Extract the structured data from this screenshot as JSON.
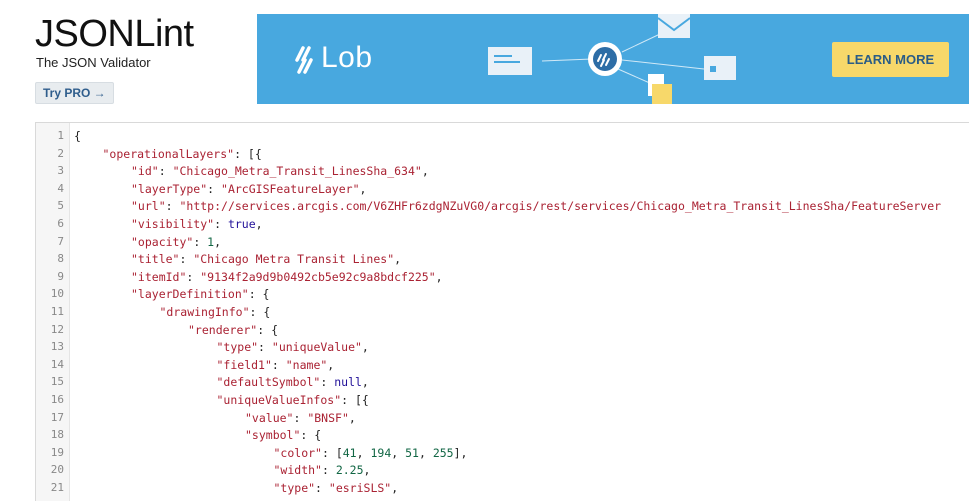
{
  "brand": {
    "title": "JSONLint",
    "subtitle": "The JSON Validator",
    "try_pro_label": "Try PRO →"
  },
  "ad": {
    "logo_text": "Lob",
    "cta_label": "LEARN MORE",
    "background": "#48a8df",
    "cta_color": "#f7d86a"
  },
  "editor": {
    "lines": [
      {
        "num": "1",
        "indent": 0,
        "tokens": [
          {
            "t": "p",
            "v": "{"
          }
        ]
      },
      {
        "num": "2",
        "indent": 1,
        "tokens": [
          {
            "t": "k",
            "v": "\"operationalLayers\""
          },
          {
            "t": "p",
            "v": ": [{"
          }
        ]
      },
      {
        "num": "3",
        "indent": 2,
        "tokens": [
          {
            "t": "k",
            "v": "\"id\""
          },
          {
            "t": "p",
            "v": ": "
          },
          {
            "t": "s",
            "v": "\"Chicago_Metra_Transit_LinesSha_634\""
          },
          {
            "t": "p",
            "v": ","
          }
        ]
      },
      {
        "num": "4",
        "indent": 2,
        "tokens": [
          {
            "t": "k",
            "v": "\"layerType\""
          },
          {
            "t": "p",
            "v": ": "
          },
          {
            "t": "s",
            "v": "\"ArcGISFeatureLayer\""
          },
          {
            "t": "p",
            "v": ","
          }
        ]
      },
      {
        "num": "5",
        "indent": 2,
        "tokens": [
          {
            "t": "k",
            "v": "\"url\""
          },
          {
            "t": "p",
            "v": ": "
          },
          {
            "t": "s",
            "v": "\"http://services.arcgis.com/V6ZHFr6zdgNZuVG0/arcgis/rest/services/Chicago_Metra_Transit_LinesSha/FeatureServer"
          }
        ]
      },
      {
        "num": "6",
        "indent": 2,
        "tokens": [
          {
            "t": "k",
            "v": "\"visibility\""
          },
          {
            "t": "p",
            "v": ": "
          },
          {
            "t": "b",
            "v": "true"
          },
          {
            "t": "p",
            "v": ","
          }
        ]
      },
      {
        "num": "7",
        "indent": 2,
        "tokens": [
          {
            "t": "k",
            "v": "\"opacity\""
          },
          {
            "t": "p",
            "v": ": "
          },
          {
            "t": "n",
            "v": "1"
          },
          {
            "t": "p",
            "v": ","
          }
        ]
      },
      {
        "num": "8",
        "indent": 2,
        "tokens": [
          {
            "t": "k",
            "v": "\"title\""
          },
          {
            "t": "p",
            "v": ": "
          },
          {
            "t": "s",
            "v": "\"Chicago Metra Transit Lines\""
          },
          {
            "t": "p",
            "v": ","
          }
        ]
      },
      {
        "num": "9",
        "indent": 2,
        "tokens": [
          {
            "t": "k",
            "v": "\"itemId\""
          },
          {
            "t": "p",
            "v": ": "
          },
          {
            "t": "s",
            "v": "\"9134f2a9d9b0492cb5e92c9a8bdcf225\""
          },
          {
            "t": "p",
            "v": ","
          }
        ]
      },
      {
        "num": "10",
        "indent": 2,
        "tokens": [
          {
            "t": "k",
            "v": "\"layerDefinition\""
          },
          {
            "t": "p",
            "v": ": {"
          }
        ]
      },
      {
        "num": "11",
        "indent": 3,
        "tokens": [
          {
            "t": "k",
            "v": "\"drawingInfo\""
          },
          {
            "t": "p",
            "v": ": {"
          }
        ]
      },
      {
        "num": "12",
        "indent": 4,
        "tokens": [
          {
            "t": "k",
            "v": "\"renderer\""
          },
          {
            "t": "p",
            "v": ": {"
          }
        ]
      },
      {
        "num": "13",
        "indent": 5,
        "tokens": [
          {
            "t": "k",
            "v": "\"type\""
          },
          {
            "t": "p",
            "v": ": "
          },
          {
            "t": "s",
            "v": "\"uniqueValue\""
          },
          {
            "t": "p",
            "v": ","
          }
        ]
      },
      {
        "num": "14",
        "indent": 5,
        "tokens": [
          {
            "t": "k",
            "v": "\"field1\""
          },
          {
            "t": "p",
            "v": ": "
          },
          {
            "t": "s",
            "v": "\"name\""
          },
          {
            "t": "p",
            "v": ","
          }
        ]
      },
      {
        "num": "15",
        "indent": 5,
        "tokens": [
          {
            "t": "k",
            "v": "\"defaultSymbol\""
          },
          {
            "t": "p",
            "v": ": "
          },
          {
            "t": "b",
            "v": "null"
          },
          {
            "t": "p",
            "v": ","
          }
        ]
      },
      {
        "num": "16",
        "indent": 5,
        "tokens": [
          {
            "t": "k",
            "v": "\"uniqueValueInfos\""
          },
          {
            "t": "p",
            "v": ": [{"
          }
        ]
      },
      {
        "num": "17",
        "indent": 6,
        "tokens": [
          {
            "t": "k",
            "v": "\"value\""
          },
          {
            "t": "p",
            "v": ": "
          },
          {
            "t": "s",
            "v": "\"BNSF\""
          },
          {
            "t": "p",
            "v": ","
          }
        ]
      },
      {
        "num": "18",
        "indent": 6,
        "tokens": [
          {
            "t": "k",
            "v": "\"symbol\""
          },
          {
            "t": "p",
            "v": ": {"
          }
        ]
      },
      {
        "num": "19",
        "indent": 7,
        "tokens": [
          {
            "t": "k",
            "v": "\"color\""
          },
          {
            "t": "p",
            "v": ": ["
          },
          {
            "t": "n",
            "v": "41"
          },
          {
            "t": "p",
            "v": ", "
          },
          {
            "t": "n",
            "v": "194"
          },
          {
            "t": "p",
            "v": ", "
          },
          {
            "t": "n",
            "v": "51"
          },
          {
            "t": "p",
            "v": ", "
          },
          {
            "t": "n",
            "v": "255"
          },
          {
            "t": "p",
            "v": "],"
          }
        ]
      },
      {
        "num": "20",
        "indent": 7,
        "tokens": [
          {
            "t": "k",
            "v": "\"width\""
          },
          {
            "t": "p",
            "v": ": "
          },
          {
            "t": "n",
            "v": "2.25"
          },
          {
            "t": "p",
            "v": ","
          }
        ]
      },
      {
        "num": "21",
        "indent": 7,
        "tokens": [
          {
            "t": "k",
            "v": "\"type\""
          },
          {
            "t": "p",
            "v": ": "
          },
          {
            "t": "s",
            "v": "\"esriSLS\""
          },
          {
            "t": "p",
            "v": ","
          }
        ]
      }
    ]
  }
}
